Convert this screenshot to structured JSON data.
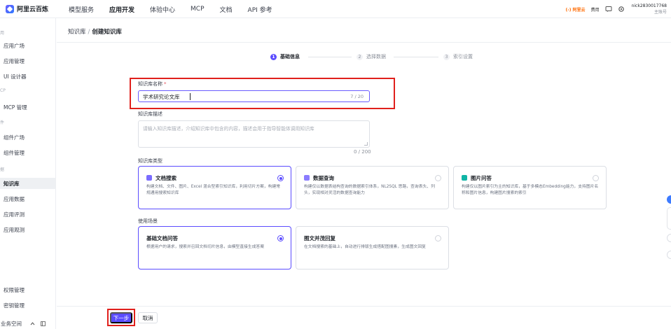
{
  "topbar": {
    "logo_text": "阿里云百炼",
    "nav": [
      "模型服务",
      "应用开发",
      "体验中心",
      "MCP",
      "文档",
      "API 参考"
    ],
    "nav_active": 1,
    "brand": "(-) 阿里云",
    "fee": "费用",
    "user_id": "nick2830017768",
    "user_role": "主账号"
  },
  "sidebar": {
    "cats": [
      "用",
      "CP",
      "件",
      "据"
    ],
    "items": [
      "应用广场",
      "应用管理",
      "UI 设计器",
      "MCP 管理",
      "组件广场",
      "组件管理",
      "知识库",
      "应用数据",
      "应用评测",
      "应用观测",
      "权限管理",
      "密钥管理",
      "业务空间"
    ],
    "active_index": 6
  },
  "breadcrumb": {
    "parent": "知识库",
    "sep": "/",
    "current": "创建知识库"
  },
  "steps": [
    {
      "num": "1",
      "label": "基础信息"
    },
    {
      "num": "2",
      "label": "选择数据"
    },
    {
      "num": "3",
      "label": "索引设置"
    }
  ],
  "form": {
    "name_label": "知识库名称",
    "required_mark": "*",
    "name_value": "学术研究论文库",
    "name_count": "7 / 20",
    "desc_label": "知识库描述",
    "desc_placeholder": "请输入知识库描述，介绍知识库中包含的内容，描述会用于指导智能体调用知识库",
    "desc_count": "0 / 200",
    "type_label": "知识库类型",
    "types": [
      {
        "title": "文档搜索",
        "desc": "构建文档、文件、图片、Excel 混合型索引知识库，利用切片方案，构建常规通用搜索知识库",
        "color": "#6a5cff"
      },
      {
        "title": "数据查询",
        "desc": "构建仅以数据表结构查询的数据索引体系，NL2SQL 思路，查询表头、列头，实现相对灵活的数据查询能力",
        "color": "#6a5cff"
      },
      {
        "title": "图片问答",
        "desc": "构建仅以图片索引为主的知识库，基于多模态Embedding能力，支持图片名称和图片信息，构建图片搜索的索引",
        "color": "#10b5a6"
      }
    ],
    "type_selected": 0,
    "scene_label": "使用场景",
    "scenes": [
      {
        "title": "基础文档问答",
        "desc": "根据用户的请求，搜索并召回文档切片信息，由模型直接生成答案"
      },
      {
        "title": "图文并茂回复",
        "desc": "在文档搜索的基础上，自动进行排版生成搭配图搜素，生成图文回复"
      }
    ],
    "scene_selected": 0
  },
  "footer": {
    "next": "下一步",
    "cancel": "取消"
  }
}
